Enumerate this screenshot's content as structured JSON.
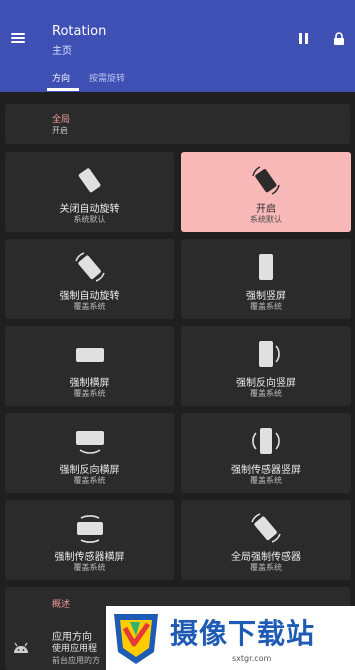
{
  "header": {
    "title": "Rotation",
    "subtitle": "主页",
    "tabs": [
      {
        "label": "方向"
      },
      {
        "label": "按需旋转"
      }
    ]
  },
  "global_setting": {
    "label": "全局",
    "value": "开启"
  },
  "tiles": [
    {
      "label": "关闭自动旋转",
      "sub": "系统默认",
      "icon": "phone-tilted-icon"
    },
    {
      "label": "开启",
      "sub": "系统默认",
      "icon": "phone-rotate-icon",
      "highlighted": true
    },
    {
      "label": "强制自动旋转",
      "sub": "覆盖系统",
      "icon": "force-auto-rotate-icon"
    },
    {
      "label": "强制竖屏",
      "sub": "覆盖系统",
      "icon": "portrait-icon"
    },
    {
      "label": "强制横屏",
      "sub": "覆盖系统",
      "icon": "landscape-icon"
    },
    {
      "label": "强制反向竖屏",
      "sub": "覆盖系统",
      "icon": "reverse-portrait-icon"
    },
    {
      "label": "强制反向横屏",
      "sub": "覆盖系统",
      "icon": "reverse-landscape-icon"
    },
    {
      "label": "强制传感器竖屏",
      "sub": "覆盖系统",
      "icon": "sensor-portrait-icon"
    },
    {
      "label": "强制传感器横屏",
      "sub": "覆盖系统",
      "icon": "sensor-landscape-icon"
    },
    {
      "label": "全局强制传感器",
      "sub": "覆盖系统",
      "icon": "global-sensor-icon"
    }
  ],
  "overview": {
    "heading": "概述",
    "line1": "应用方向",
    "line2": "使用应用程",
    "line3": "前台应用的方"
  },
  "watermark": {
    "text": "摄像下载站",
    "url": "sxtgr.com"
  },
  "colors": {
    "appbar": "#3e50b4",
    "background": "#1f1f1f",
    "card": "#2b2b2b",
    "highlight": "#f8b8b8",
    "accent_text": "#f19a9a"
  }
}
